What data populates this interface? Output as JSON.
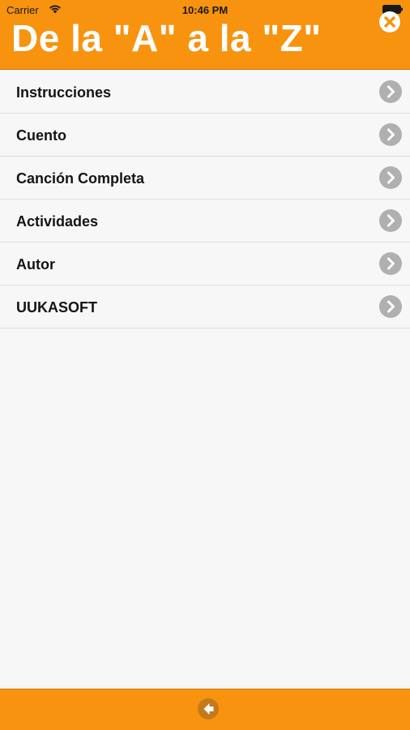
{
  "status_bar": {
    "carrier": "Carrier",
    "time": "10:46 PM"
  },
  "header": {
    "title": "De la \"A\" a la \"Z\"",
    "close_icon": "close-icon"
  },
  "menu": {
    "items": [
      {
        "label": "Instrucciones"
      },
      {
        "label": "Cuento"
      },
      {
        "label": "Canción Completa"
      },
      {
        "label": "Actividades"
      },
      {
        "label": "Autor"
      },
      {
        "label": "UUKASOFT"
      }
    ],
    "chevron_icon": "chevron-right-icon"
  },
  "footer": {
    "back_icon": "back-arrow-icon"
  },
  "colors": {
    "accent": "#f7930f",
    "background": "#f7f7f7",
    "chevron": "#b0b0b0",
    "back_button": "#c47a1a"
  }
}
